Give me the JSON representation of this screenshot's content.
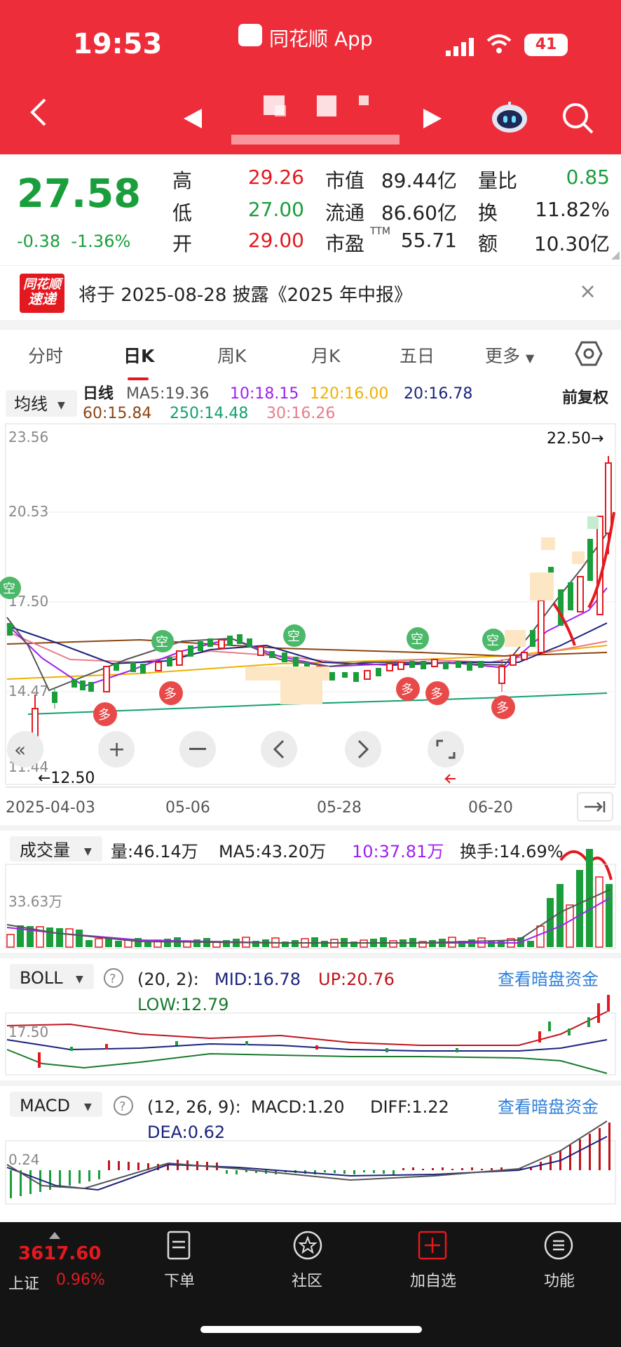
{
  "status": {
    "time": "19:53",
    "app": "同花顺 App",
    "battery": "41"
  },
  "quote": {
    "price": "27.58",
    "change": "-0.38",
    "change_pct": "-1.36%",
    "fields": [
      {
        "label": "高",
        "value": "29.26",
        "color": "red"
      },
      {
        "label": "低",
        "value": "27.00",
        "color": "green"
      },
      {
        "label": "开",
        "value": "29.00",
        "color": "red"
      }
    ],
    "fields2": [
      {
        "label": "市值",
        "value": "89.44亿"
      },
      {
        "label": "流通",
        "value": "86.60亿"
      },
      {
        "label": "市盈",
        "sup": "TTM",
        "value": "55.71"
      }
    ],
    "fields3": [
      {
        "label": "量比",
        "value": "0.85",
        "color": "green"
      },
      {
        "label": "换",
        "value": "11.82%"
      },
      {
        "label": "额",
        "value": "10.30亿"
      }
    ]
  },
  "notice": {
    "logo_top": "同花顺",
    "logo_bottom": "速递",
    "text": "将于 2025-08-28 披露《2025 年中报》",
    "close": "×"
  },
  "tabs": [
    "分时",
    "日K",
    "周K",
    "月K",
    "五日",
    "更多"
  ],
  "kline": {
    "ma_button": "均线",
    "label": "日线",
    "adj": "前复权",
    "ma_items": [
      {
        "text": "MA5:19.36",
        "color": "#555555"
      },
      {
        "text": "10:18.15",
        "color": "#a020f0"
      },
      {
        "text": "120:16.00",
        "color": "#f0b000"
      },
      {
        "text": "20:16.78",
        "color": "#1a237e"
      },
      {
        "text": "60:15.84",
        "color": "#8b4513"
      },
      {
        "text": "250:14.48",
        "color": "#14a06e"
      },
      {
        "text": "30:16.26",
        "color": "#e87c8a"
      }
    ],
    "y_ticks": [
      "23.56",
      "20.53",
      "17.50",
      "14.47",
      "11.44"
    ],
    "high_mark": "22.50→",
    "low_mark": "←12.50",
    "dates": [
      "2025-04-03",
      "05-06",
      "05-28",
      "06-20"
    ],
    "sig_kong": "空",
    "sig_duo": "多"
  },
  "volume": {
    "button": "成交量",
    "vol": "量:46.14万",
    "ma5": "MA5:43.20万",
    "ma10": "10:37.81万",
    "turnover": "换手:14.69%",
    "tick": "33.63万"
  },
  "boll": {
    "button": "BOLL",
    "params": "(20, 2):",
    "mid": "MID:16.78",
    "up": "UP:20.76",
    "low": "LOW:12.79",
    "link": "查看暗盘资金",
    "tick": "17.50"
  },
  "macd": {
    "button": "MACD",
    "params": "(12, 26, 9):",
    "macd": "MACD:1.20",
    "diff": "DIFF:1.22",
    "dea": "DEA:0.62",
    "link": "查看暗盘资金",
    "tick": "0.24"
  },
  "bottom": {
    "index_value": "3617.60",
    "index_name": "上证",
    "index_pct": "0.96%",
    "items": [
      "下单",
      "社区",
      "加自选",
      "功能"
    ]
  }
}
